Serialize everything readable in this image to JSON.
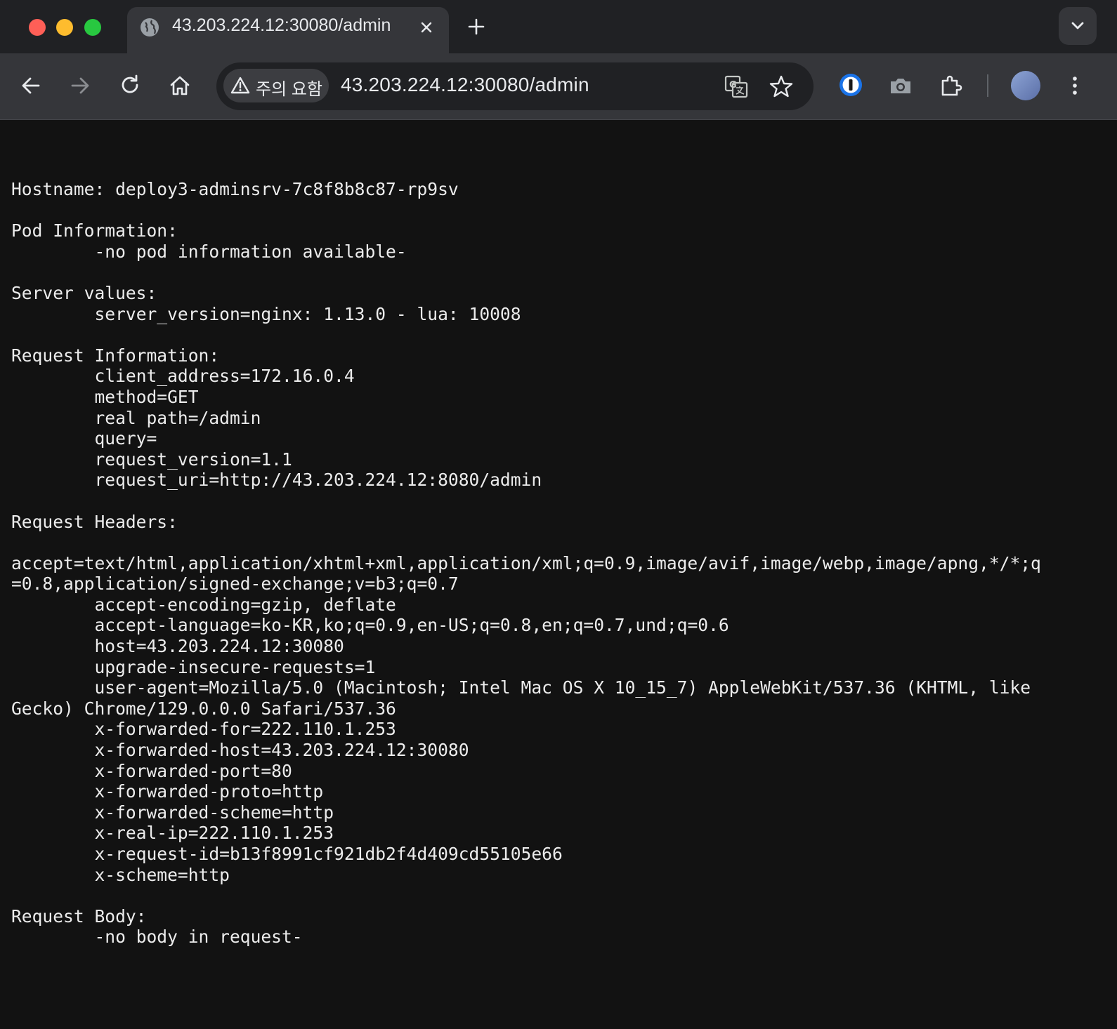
{
  "browser": {
    "tab": {
      "title": "43.203.224.12:30080/admin",
      "icon": "globe-icon"
    },
    "security_chip": {
      "label": "주의 요함",
      "icon": "warning-icon"
    },
    "url": "43.203.224.12:30080/admin",
    "toolbar_icons": [
      "back-icon",
      "forward-icon",
      "reload-icon",
      "home-icon",
      "translate-icon",
      "star-icon",
      "password-manager-icon",
      "camera-icon",
      "extensions-icon",
      "profile-avatar",
      "menu-icon"
    ]
  },
  "page": {
    "hostname": {
      "label": "Hostname: ",
      "value": "deploy3-adminsrv-7c8f8b8c87-rp9sv"
    },
    "pod_info": {
      "heading": "Pod Information:",
      "value": "-no pod information available-"
    },
    "server_values": {
      "heading": "Server values:",
      "value": "server_version=nginx: 1.13.0 - lua: 10008"
    },
    "request_info": {
      "heading": "Request Information:",
      "lines": [
        "client_address=172.16.0.4",
        "method=GET",
        "real path=/admin",
        "query=",
        "request_version=1.1",
        "request_uri=http://43.203.224.12:8080/admin"
      ]
    },
    "request_headers": {
      "heading": "Request Headers:",
      "accept_line1": "accept=text/html,application/xhtml+xml,application/xml;q=0.9,image/avif,image/webp,image/apng,*/*;q",
      "accept_line2": "=0.8,application/signed-exchange;v=b3;q=0.7",
      "lines_a": [
        "accept-encoding=gzip, deflate",
        "accept-language=ko-KR,ko;q=0.9,en-US;q=0.8,en;q=0.7,und;q=0.6",
        "host=43.203.224.12:30080",
        "upgrade-insecure-requests=1"
      ],
      "user_agent_line1": "user-agent=Mozilla/5.0 (Macintosh; Intel Mac OS X 10_15_7) AppleWebKit/537.36 (KHTML, like",
      "user_agent_line2": "Gecko) Chrome/129.0.0.0 Safari/537.36",
      "lines_b": [
        "x-forwarded-for=222.110.1.253",
        "x-forwarded-host=43.203.224.12:30080",
        "x-forwarded-port=80",
        "x-forwarded-proto=http",
        "x-forwarded-scheme=http",
        "x-real-ip=222.110.1.253",
        "x-request-id=b13f8991cf921db2f4d409cd55105e66",
        "x-scheme=http"
      ]
    },
    "request_body": {
      "heading": "Request Body:",
      "value": "-no body in request-"
    }
  }
}
